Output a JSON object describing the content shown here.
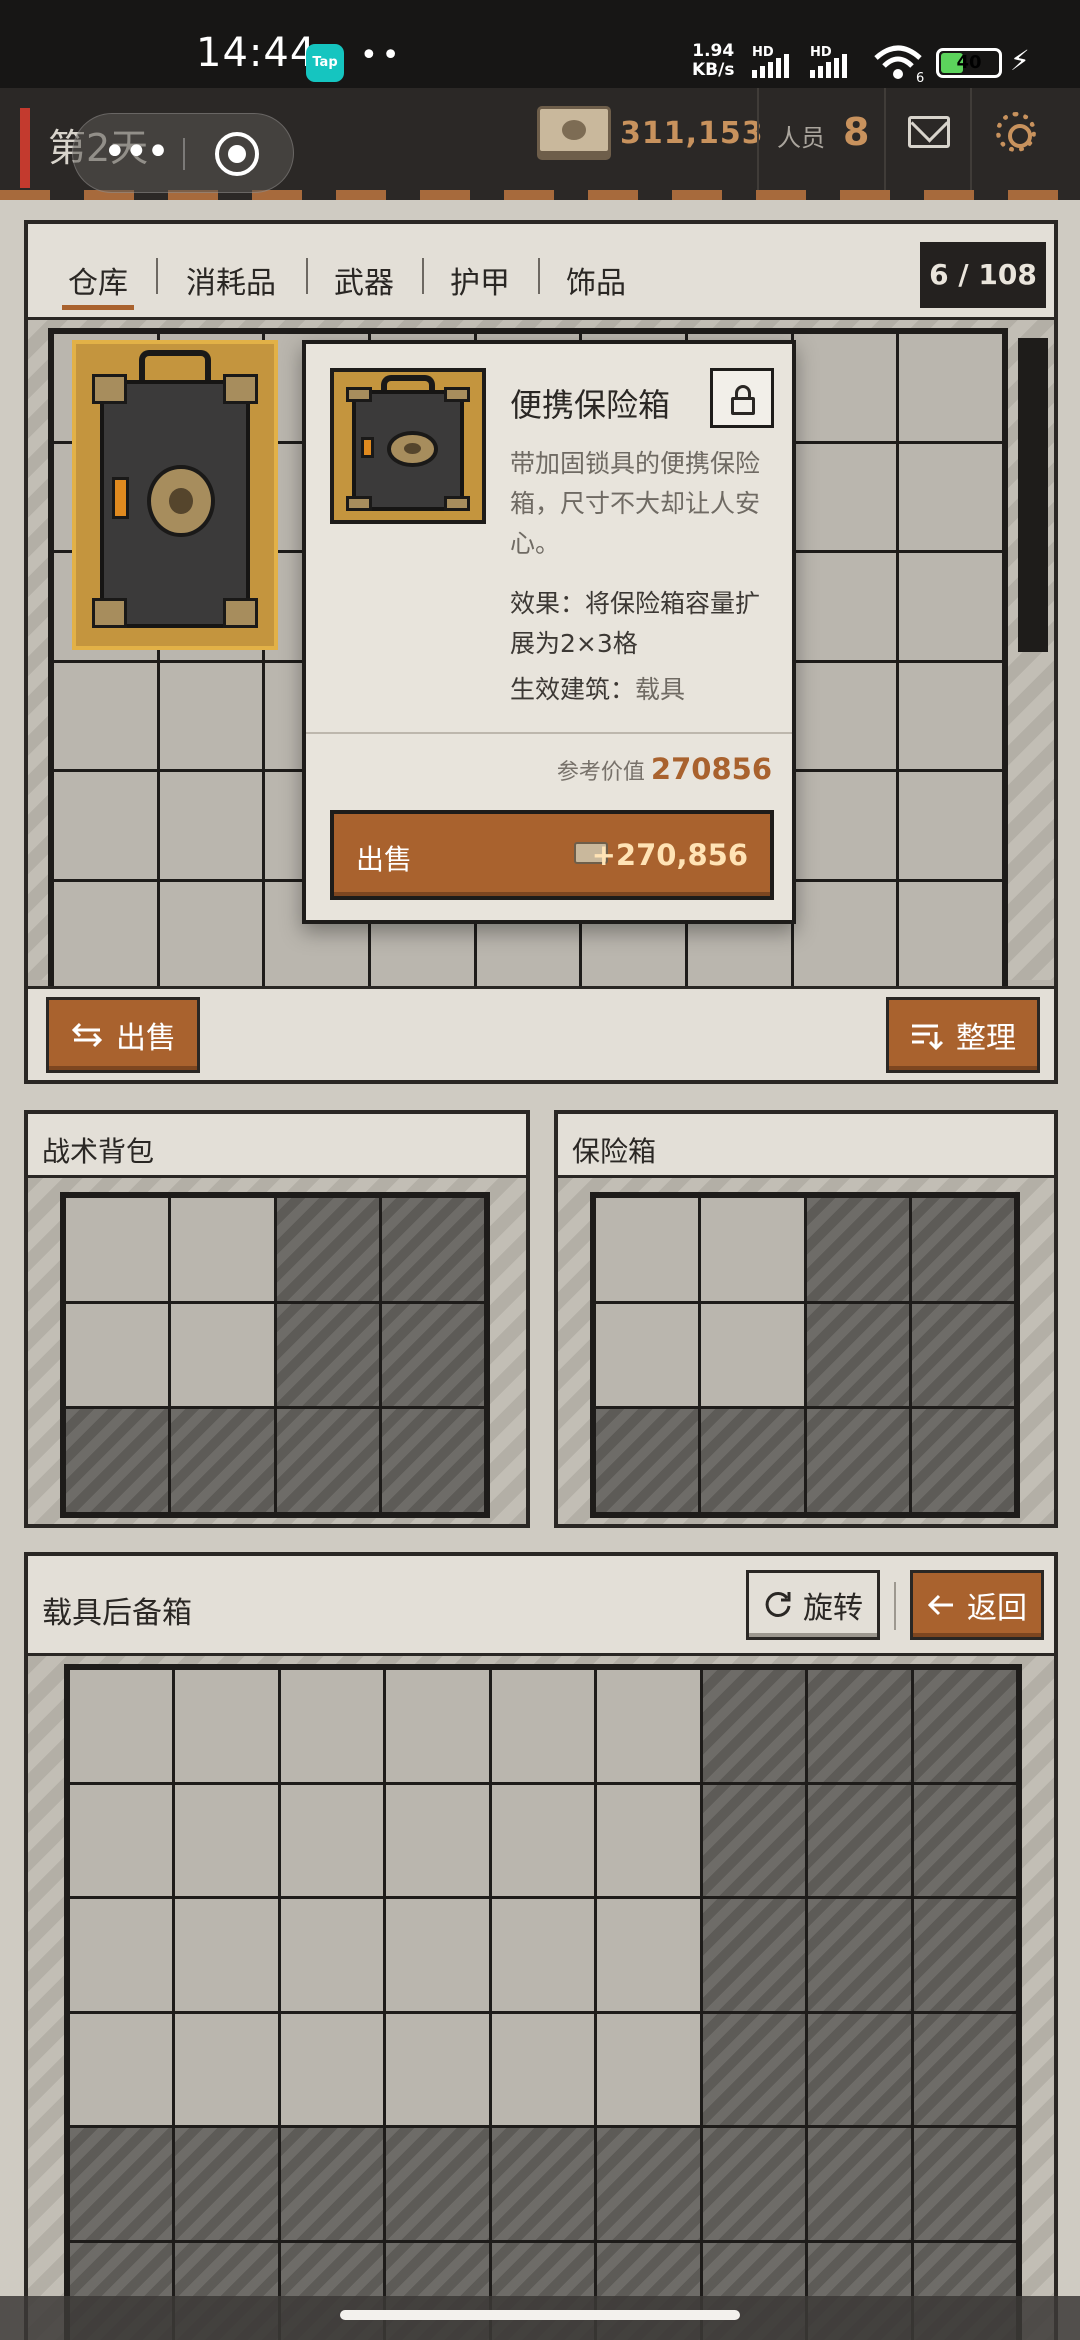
{
  "status_bar": {
    "time": "14:44",
    "app_badge": "Tap",
    "dots": "••",
    "net_speed_value": "1.94",
    "net_speed_unit": "KB/s",
    "hd1": "HD",
    "hd2": "HD",
    "wifi_sub": "6",
    "battery": "40",
    "battery_level": 0.4
  },
  "top_bar": {
    "day_label": "第2天",
    "cash_value": "311,153",
    "staff_label": "人员",
    "staff_value": "8"
  },
  "warehouse": {
    "tabs": [
      {
        "label": "仓库",
        "active": true
      },
      {
        "label": "消耗品",
        "active": false
      },
      {
        "label": "武器",
        "active": false
      },
      {
        "label": "护甲",
        "active": false
      },
      {
        "label": "饰品",
        "active": false
      }
    ],
    "capacity": "6 / 108",
    "sell_button": "出售",
    "sort_button": "整理"
  },
  "tooltip": {
    "item_name": "便携保险箱",
    "description": "带加固锁具的便携保险箱，尺寸不大却让人安心。",
    "effect": "效果：将保险箱容量扩展为2×3格",
    "building_label": "生效建筑：",
    "building_value": "载具",
    "ref_label": "参考价值",
    "ref_value": "270856",
    "sell_label": "出售",
    "sell_value": "+270,856"
  },
  "backpack": {
    "title": "战术背包"
  },
  "safebox": {
    "title": "保险箱"
  },
  "trunk": {
    "title": "载具后备箱",
    "rotate_button": "旋转",
    "back_button": "返回"
  },
  "icons": {
    "cash": "banknote-icon",
    "mail": "envelope-icon",
    "settings": "gear-icon",
    "unlock": "unlock-icon",
    "sell": "swap-icon",
    "sort": "sort-icon",
    "rotate": "rotate-icon",
    "back": "arrow-left-icon"
  },
  "colors": {
    "accent": "#a9622e",
    "gold": "#c8925d",
    "item_bg": "#c4953e"
  }
}
